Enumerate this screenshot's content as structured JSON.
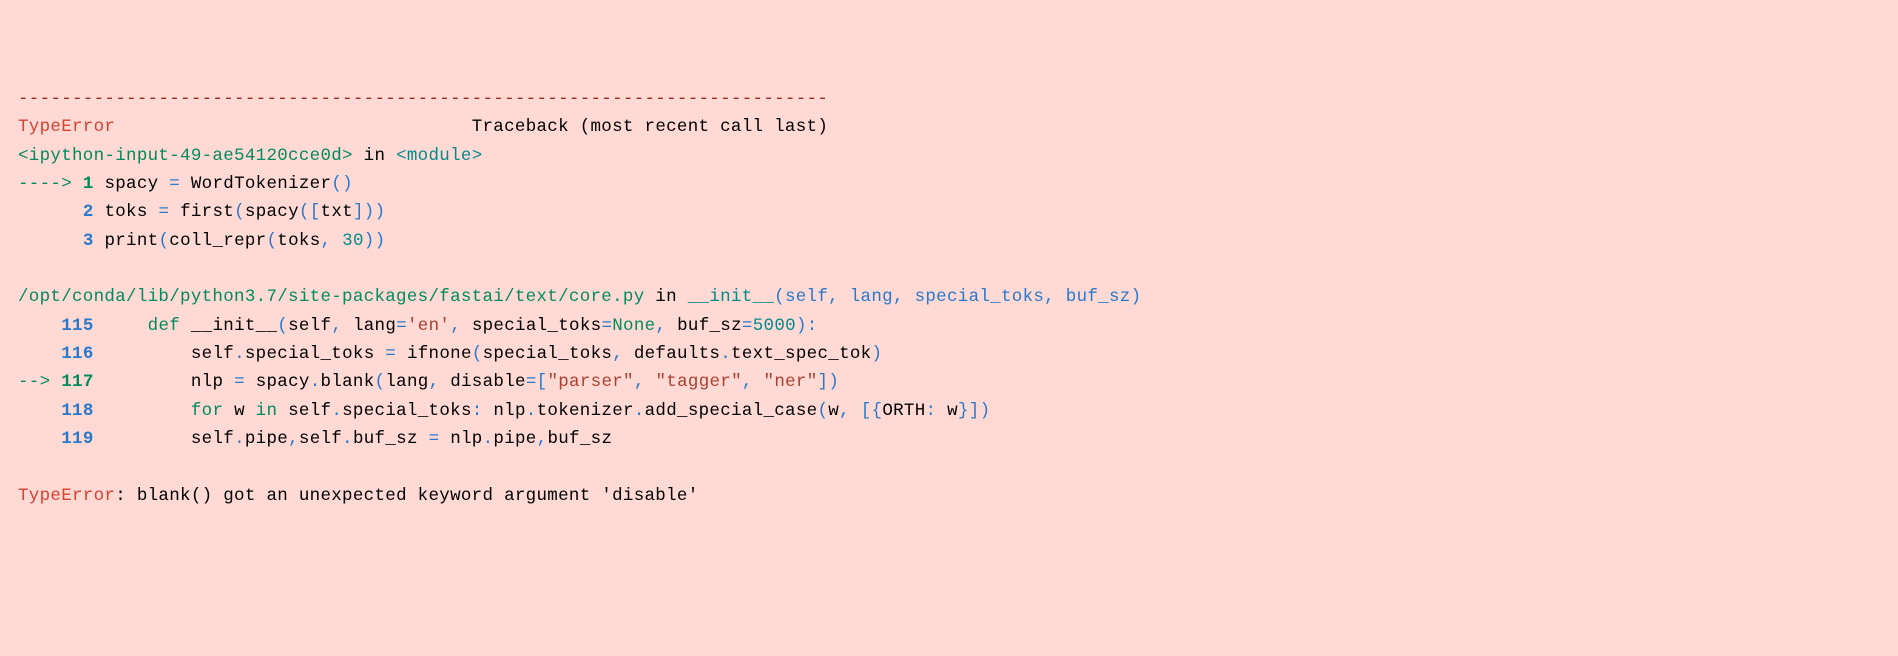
{
  "traceback": {
    "separator": "---------------------------------------------------------------------------",
    "error_type": "TypeError",
    "header_right": "Traceback (most recent call last)",
    "frame1": {
      "location": "<ipython-input-49-ae54120cce0d>",
      "in_word": " in ",
      "func": "<module>",
      "arrow": "----> ",
      "line1": {
        "num": "1",
        "space": " ",
        "a": "spacy ",
        "eq": "=",
        "b": " WordTokenizer",
        "p1": "(",
        "p2": ")"
      },
      "pad2": "      ",
      "line2": {
        "num": "2",
        "space": " ",
        "a": "toks ",
        "eq": "=",
        "b": " first",
        "p1": "(",
        "c": "spacy",
        "p2": "(",
        "p3": "[",
        "d": "txt",
        "p4": "]",
        "p5": ")",
        "p6": ")"
      },
      "pad3": "      ",
      "line3": {
        "num": "3",
        "space": " ",
        "a": "print",
        "p1": "(",
        "b": "coll_repr",
        "p2": "(",
        "c": "toks",
        "comma": ",",
        "sp": " ",
        "n30": "30",
        "p3": ")",
        "p4": ")"
      }
    },
    "frame2": {
      "location": "/opt/conda/lib/python3.7/site-packages/fastai/text/core.py",
      "in_word": " in ",
      "func": "__init__",
      "sig_open": "(self, lang, special_toks, buf_sz)",
      "pad115": "    ",
      "l115": {
        "num": "115",
        "indent": "     ",
        "def": "def",
        "sp1": " ",
        "fn": "__init__",
        "p1": "(",
        "self": "self",
        "c1": ",",
        "sp2": " ",
        "lang": "lang",
        "eq1": "=",
        "en": "'en'",
        "c2": ",",
        "sp3": " ",
        "st": "special_toks",
        "eq2": "=",
        "none": "None",
        "c3": ",",
        "sp4": " ",
        "bs": "buf_sz",
        "eq3": "=",
        "v5000": "5000",
        "p2": ")",
        "colon": ":"
      },
      "pad116": "    ",
      "l116": {
        "num": "116",
        "indent": "         ",
        "a": "self",
        "dot1": ".",
        "b": "special_toks ",
        "eq": "=",
        "sp": " ",
        "c": "ifnone",
        "p1": "(",
        "d": "special_toks",
        "c1": ",",
        "sp2": " ",
        "e": "defaults",
        "dot2": ".",
        "f": "text_spec_tok",
        "p2": ")"
      },
      "arrow117": "--> ",
      "l117": {
        "num": "117",
        "indent": "         ",
        "a": "nlp ",
        "eq": "=",
        "sp": " ",
        "b": "spacy",
        "dot": ".",
        "c": "blank",
        "p1": "(",
        "d": "lang",
        "c1": ",",
        "sp2": " ",
        "e": "disable",
        "eq2": "=",
        "br1": "[",
        "s1": "\"parser\"",
        "c2": ",",
        "sp3": " ",
        "s2": "\"tagger\"",
        "c3": ",",
        "sp4": " ",
        "s3": "\"ner\"",
        "br2": "]",
        "p2": ")"
      },
      "pad118": "    ",
      "l118": {
        "num": "118",
        "indent": "         ",
        "for": "for",
        "sp1": " ",
        "w": "w ",
        "in": "in",
        "sp2": " ",
        "self": "self",
        "dot1": ".",
        "st": "special_toks",
        "colon": ":",
        "sp3": " ",
        "nlp": "nlp",
        "dot2": ".",
        "tok": "tokenizer",
        "dot3": ".",
        "asc": "add_special_case",
        "p1": "(",
        "w2": "w",
        "c1": ",",
        "sp4": " ",
        "br1": "[",
        "cb1": "{",
        "orth": "ORTH",
        "colon2": ":",
        "sp5": " ",
        "w3": "w",
        "cb2": "}",
        "br2": "]",
        "p2": ")"
      },
      "pad119": "    ",
      "l119": {
        "num": "119",
        "indent": "         ",
        "self1": "self",
        "dot1": ".",
        "pipe1": "pipe",
        "c1": ",",
        "self2": "self",
        "dot2": ".",
        "bs": "buf_sz ",
        "eq": "=",
        "sp": " ",
        "nlp": "nlp",
        "dot3": ".",
        "pipe2": "pipe",
        "c2": ",",
        "bs2": "buf_sz"
      }
    },
    "final_error_type": "TypeError",
    "final_error_msg": ": blank() got an unexpected keyword argument 'disable'"
  }
}
